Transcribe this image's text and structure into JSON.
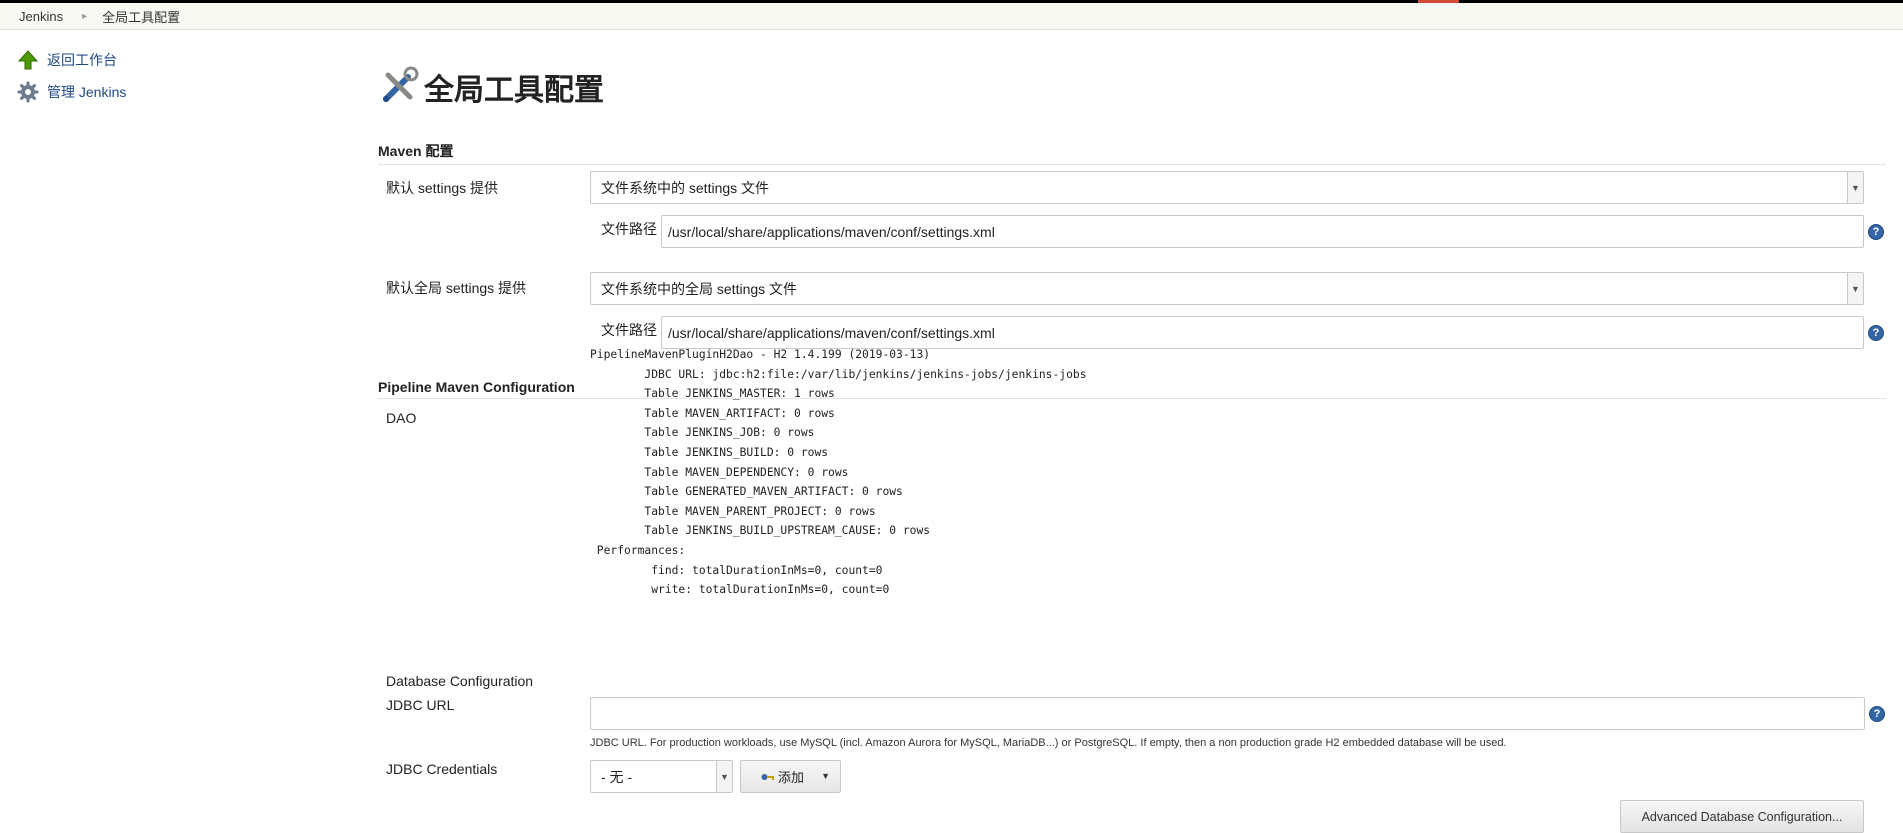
{
  "breadcrumb": {
    "root": "Jenkins",
    "current": "全局工具配置"
  },
  "sidebar": {
    "items": [
      {
        "label": "返回工作台",
        "icon": "up-arrow-icon"
      },
      {
        "label": "管理 Jenkins",
        "icon": "gear-icon"
      }
    ]
  },
  "page": {
    "title": "全局工具配置",
    "icon": "tools-icon"
  },
  "maven": {
    "header": "Maven 配置",
    "settings_label": "默认 settings 提供",
    "settings_value": "文件系统中的 settings 文件",
    "settings_path_label": "文件路径",
    "settings_path_value": "/usr/local/share/applications/maven/conf/settings.xml",
    "global_settings_label": "默认全局 settings 提供",
    "global_settings_value": "文件系统中的全局 settings 文件",
    "global_path_label": "文件路径",
    "global_path_value": "/usr/local/share/applications/maven/conf/settings.xml"
  },
  "pipeline": {
    "header": "Pipeline Maven Configuration",
    "dao_label": "DAO",
    "dao_text": "PipelineMavenPluginH2Dao - H2 1.4.199 (2019-03-13)\n        JDBC URL: jdbc:h2:file:/var/lib/jenkins/jenkins-jobs/jenkins-jobs\n        Table JENKINS_MASTER: 1 rows\n        Table MAVEN_ARTIFACT: 0 rows\n        Table JENKINS_JOB: 0 rows\n        Table JENKINS_BUILD: 0 rows\n        Table MAVEN_DEPENDENCY: 0 rows\n        Table GENERATED_MAVEN_ARTIFACT: 0 rows\n        Table MAVEN_PARENT_PROJECT: 0 rows\n        Table JENKINS_BUILD_UPSTREAM_CAUSE: 0 rows\n Performances:\n         find: totalDurationInMs=0, count=0\n         write: totalDurationInMs=0, count=0",
    "db_config_label": "Database Configuration",
    "jdbc_url_label": "JDBC URL",
    "jdbc_url_value": "",
    "jdbc_hint": "JDBC URL. For production workloads, use MySQL (incl. Amazon Aurora for MySQL, MariaDB...) or PostgreSQL. If empty, then a non production grade H2 embedded database will be used.",
    "jdbc_credentials_label": "JDBC Credentials",
    "credentials_value": "- 无 -",
    "add_label": "添加",
    "advanced_label": "Advanced Database Configuration..."
  },
  "colors": {
    "link": "#204a87",
    "help": "#3465a4",
    "accent": "#d24939"
  }
}
